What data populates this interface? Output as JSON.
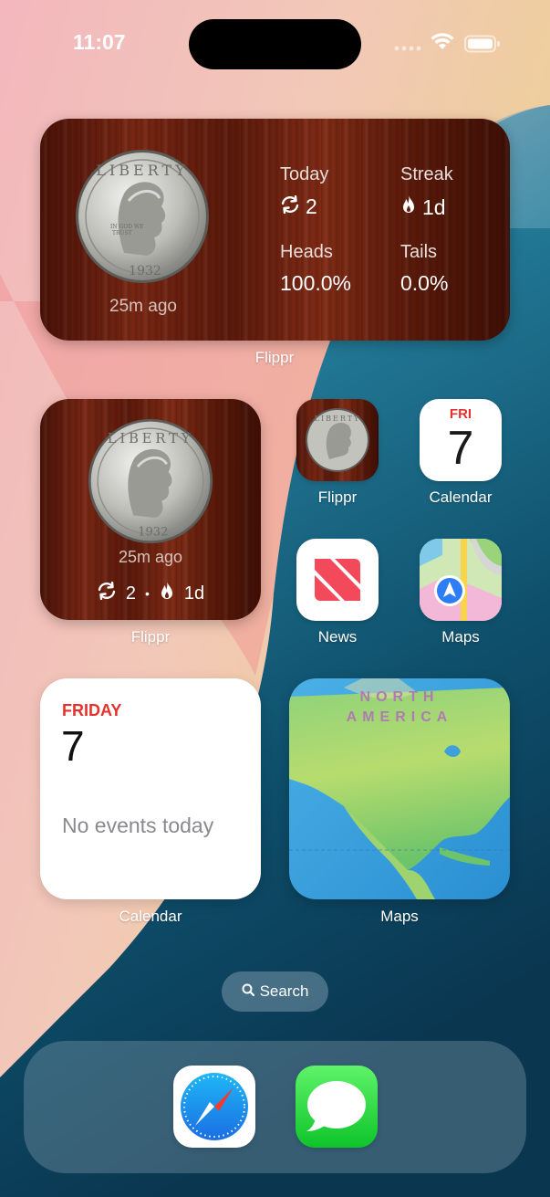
{
  "status": {
    "time": "11:07"
  },
  "flippr_large": {
    "ago": "25m ago",
    "today_label": "Today",
    "today_value": "2",
    "streak_label": "Streak",
    "streak_value": "1d",
    "heads_label": "Heads",
    "heads_value": "100.0%",
    "tails_label": "Tails",
    "tails_value": "0.0%",
    "caption": "Flippr"
  },
  "flippr_small": {
    "ago": "25m ago",
    "count": "2",
    "dot": "•",
    "streak": "1d",
    "caption": "Flippr"
  },
  "apps": {
    "flippr": "Flippr",
    "calendar": "Calendar",
    "calendar_day": "FRI",
    "calendar_date": "7",
    "news": "News",
    "maps": "Maps"
  },
  "calendar_widget": {
    "day": "FRIDAY",
    "date": "7",
    "events": "No events today",
    "caption": "Calendar"
  },
  "maps_widget": {
    "region_line1": "NORTH",
    "region_line2": "AMERICA",
    "caption": "Maps"
  },
  "search": {
    "label": "Search"
  },
  "colors": {
    "calendar_red": "#e5322d",
    "wood": "#6b2010"
  }
}
